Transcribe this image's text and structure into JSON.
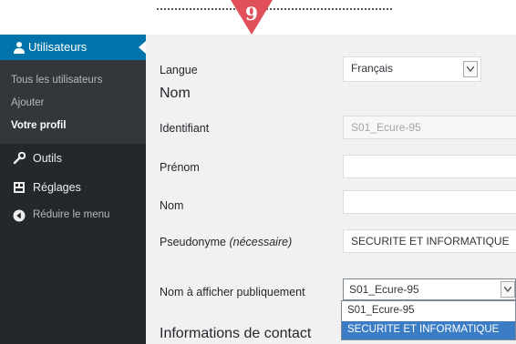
{
  "step": {
    "number": "9",
    "marker_color": "#e0505a"
  },
  "sidebar": {
    "users_menu": {
      "label": "Utilisateurs",
      "icon": "user-icon"
    },
    "submenu": [
      {
        "label": "Tous les utilisateurs",
        "current": false
      },
      {
        "label": "Ajouter",
        "current": false
      },
      {
        "label": "Votre profil",
        "current": true
      }
    ],
    "items": [
      {
        "label": "Outils",
        "icon": "wrench-icon"
      },
      {
        "label": "Réglages",
        "icon": "settings-icon"
      },
      {
        "label": "Réduire le menu",
        "icon": "collapse-icon"
      }
    ]
  },
  "form": {
    "language": {
      "label": "Langue",
      "value": "Français"
    },
    "name_heading": "Nom",
    "username": {
      "label": "Identifiant",
      "value": "S01_Ecure-95"
    },
    "first_name": {
      "label": "Prénom",
      "value": ""
    },
    "last_name": {
      "label": "Nom",
      "value": ""
    },
    "nickname": {
      "label": "Pseudonyme",
      "label_note": "(nécessaire)",
      "value": "SECURITE ET INFORMATIQUE"
    },
    "display_name": {
      "label": "Nom à afficher publiquement",
      "value": "S01_Ecure-95",
      "options": [
        "S01_Ecure-95",
        "SECURITE ET INFORMATIQUE"
      ],
      "highlighted_option": "SECURITE ET INFORMATIQUE"
    },
    "contact_heading": "Informations de contact"
  },
  "colors": {
    "sidebar_bg": "#23282d",
    "submenu_bg": "#32373c",
    "active_menu": "#0073aa",
    "highlight": "#3b7dc4"
  }
}
